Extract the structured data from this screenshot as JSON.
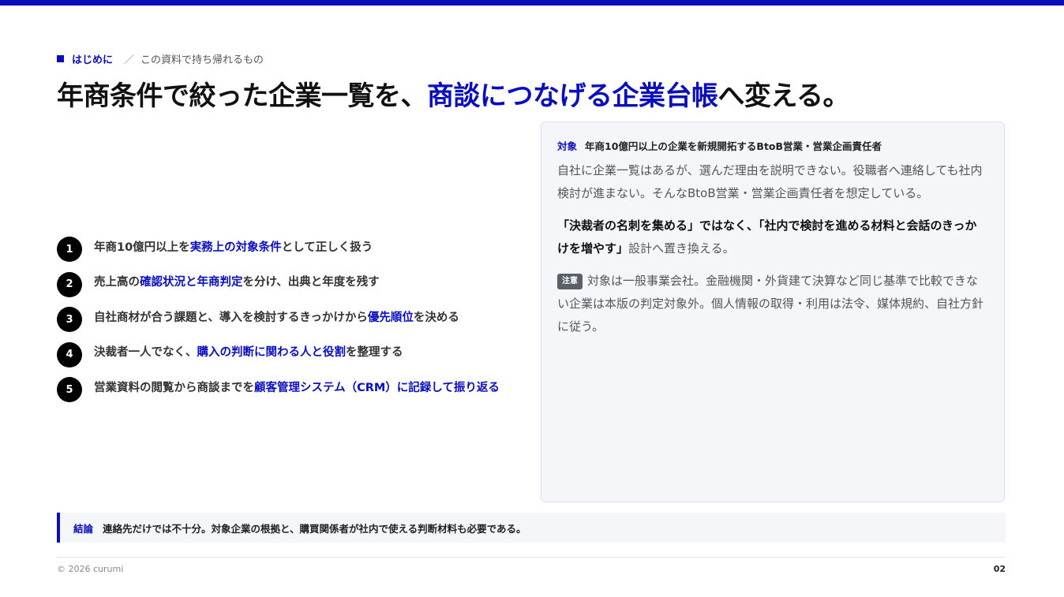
{
  "colors": {
    "accent": "#0a0fbd"
  },
  "eyebrow": {
    "section": "はじめに",
    "separator": "／",
    "subtitle": "この資料で持ち帰れるもの"
  },
  "title": {
    "before": "年商条件で絞った企業一覧を、",
    "highlight": "商談につなげる企業台帳",
    "after": "へ変える。"
  },
  "points": [
    {
      "num": "1",
      "before": "年商10億円以上を",
      "highlight": "実務上の対象条件",
      "after": "として正しく扱う"
    },
    {
      "num": "2",
      "before": "売上高の",
      "highlight": "確認状況と年商判定",
      "after": "を分け、出典と年度を残す"
    },
    {
      "num": "3",
      "before": "自社商材が合う課題と、導入を検討するきっかけから",
      "highlight": "優先順位",
      "after": "を決める"
    },
    {
      "num": "4",
      "before": "決裁者一人でなく、",
      "highlight": "購入の判断に関わる人と役割",
      "after": "を整理する"
    },
    {
      "num": "5",
      "before": "営業資料の閲覧から商談までを",
      "highlight": "顧客管理システム（CRM）に記録して振り返る",
      "after": ""
    }
  ],
  "card": {
    "audience_label": "対象",
    "audience_text": "年商10億円以上の企業を新規開拓するBtoB営業・営業企画責任者",
    "para1": "自社に企業一覧はあるが、選んだ理由を説明できない。役職者へ連絡しても社内検討が進まない。そんなBtoB営業・営業企画責任者を想定している。",
    "para2_bold": "「決裁者の名刺を集める」ではなく、「社内で検討を進める材料と会話のきっかけを増やす」",
    "para2_tail": "設計へ置き換える。",
    "note_badge": "注意",
    "note_text": "対象は一般事業会社。金融機関・外貨建て決算など同じ基準で比較できない企業は本版の判定対象外。個人情報の取得・利用は法令、媒体規約、自社方針に従う。"
  },
  "conclusion": {
    "label": "結論",
    "text": "連絡先だけでは不十分。対象企業の根拠と、購買関係者が社内で使える判断材料も必要である。"
  },
  "footer": {
    "copyright": "© 2026 curumi",
    "page": "02"
  }
}
